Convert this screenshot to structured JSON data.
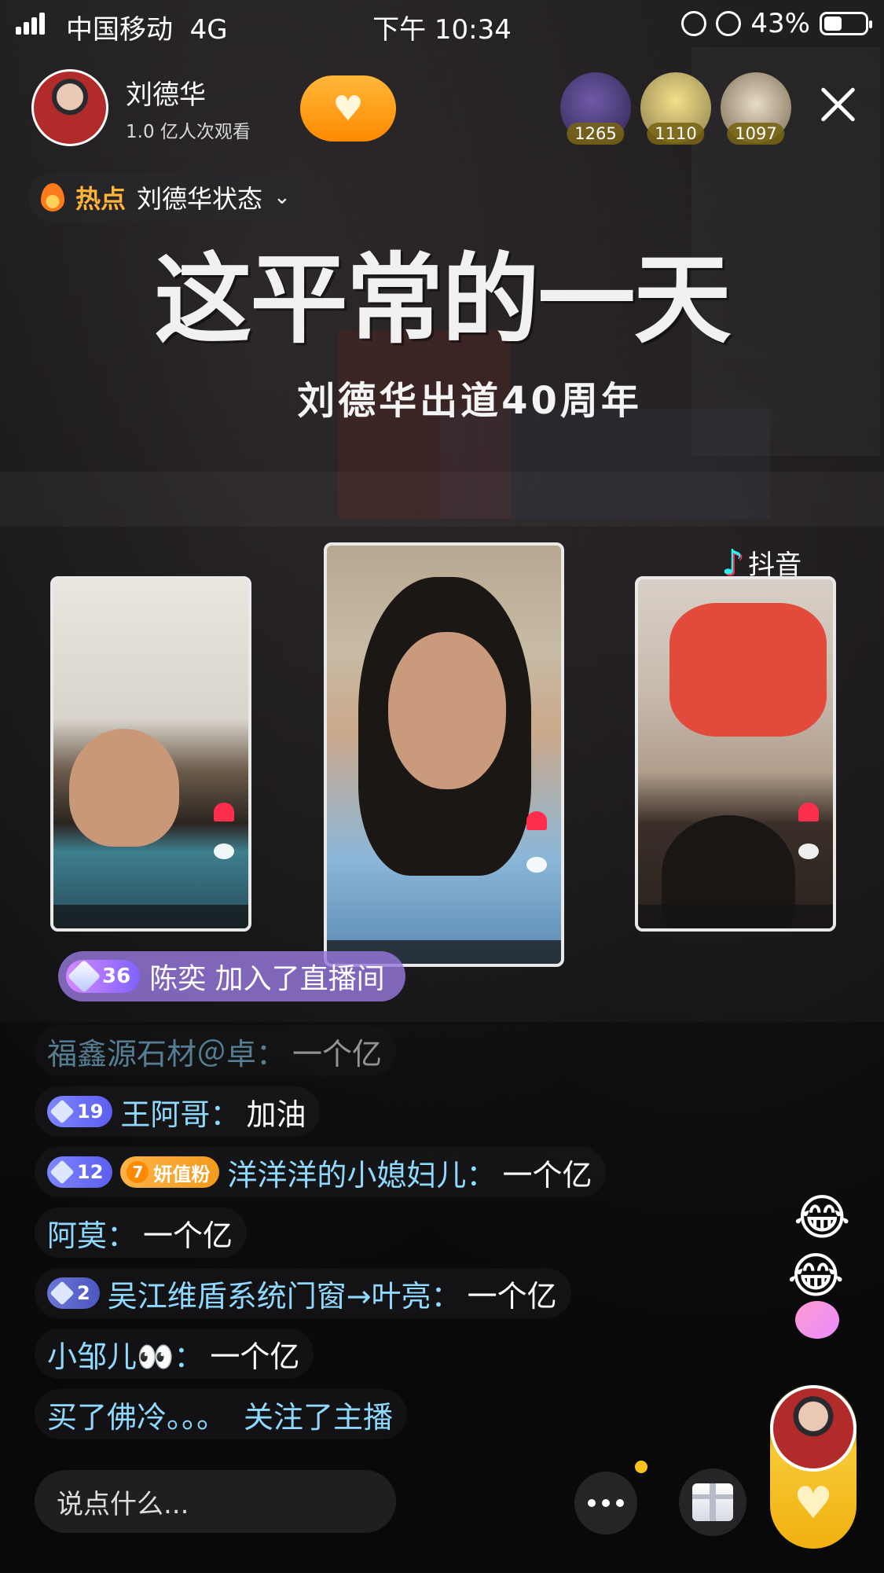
{
  "status_bar": {
    "carrier": "中国移动",
    "network": "4G",
    "time": "下午 10:34",
    "battery": "43%"
  },
  "host": {
    "name": "刘德华",
    "views": "1.0 亿人次观看"
  },
  "top_viewers": [
    {
      "count": "1265",
      "color": "#5a3f8c"
    },
    {
      "count": "1110",
      "color": "#c9b24a"
    },
    {
      "count": "1097",
      "color": "#9f8b6a"
    }
  ],
  "hot_topic": {
    "label": "热点",
    "topic": "刘德华状态"
  },
  "stage": {
    "title": "这平常的一天",
    "subtitle": "刘德华出道40周年",
    "watermark": "抖音"
  },
  "join_notice": {
    "level": "36",
    "user": "陈奕",
    "action": "加入了直播间"
  },
  "chat": [
    {
      "user": "福鑫源石材＠卓",
      "sep": "：",
      "text": "一个亿"
    },
    {
      "level": "19",
      "user": "王阿哥",
      "sep": "：",
      "text": "加油"
    },
    {
      "level": "12",
      "fan_level": "7",
      "fan_label": "妍值粉",
      "user": "洋洋洋的小媳妇儿",
      "sep": "：",
      "text": "一个亿"
    },
    {
      "user": "阿莫",
      "sep": "：",
      "text": "一个亿"
    },
    {
      "level": "2",
      "user": "吴江维盾系统门窗→叶亮",
      "sep": "：",
      "text": "一个亿"
    },
    {
      "user": "小邹儿👀",
      "sep": "：",
      "text": "一个亿"
    },
    {
      "user": "买了佛冷。。。",
      "text": "关注了主播"
    }
  ],
  "bottom": {
    "input_placeholder": "说点什么..."
  },
  "colors": {
    "accent": "#ffa31a",
    "chat_user": "#8fd9ff",
    "join_banner": "#9678dc"
  }
}
